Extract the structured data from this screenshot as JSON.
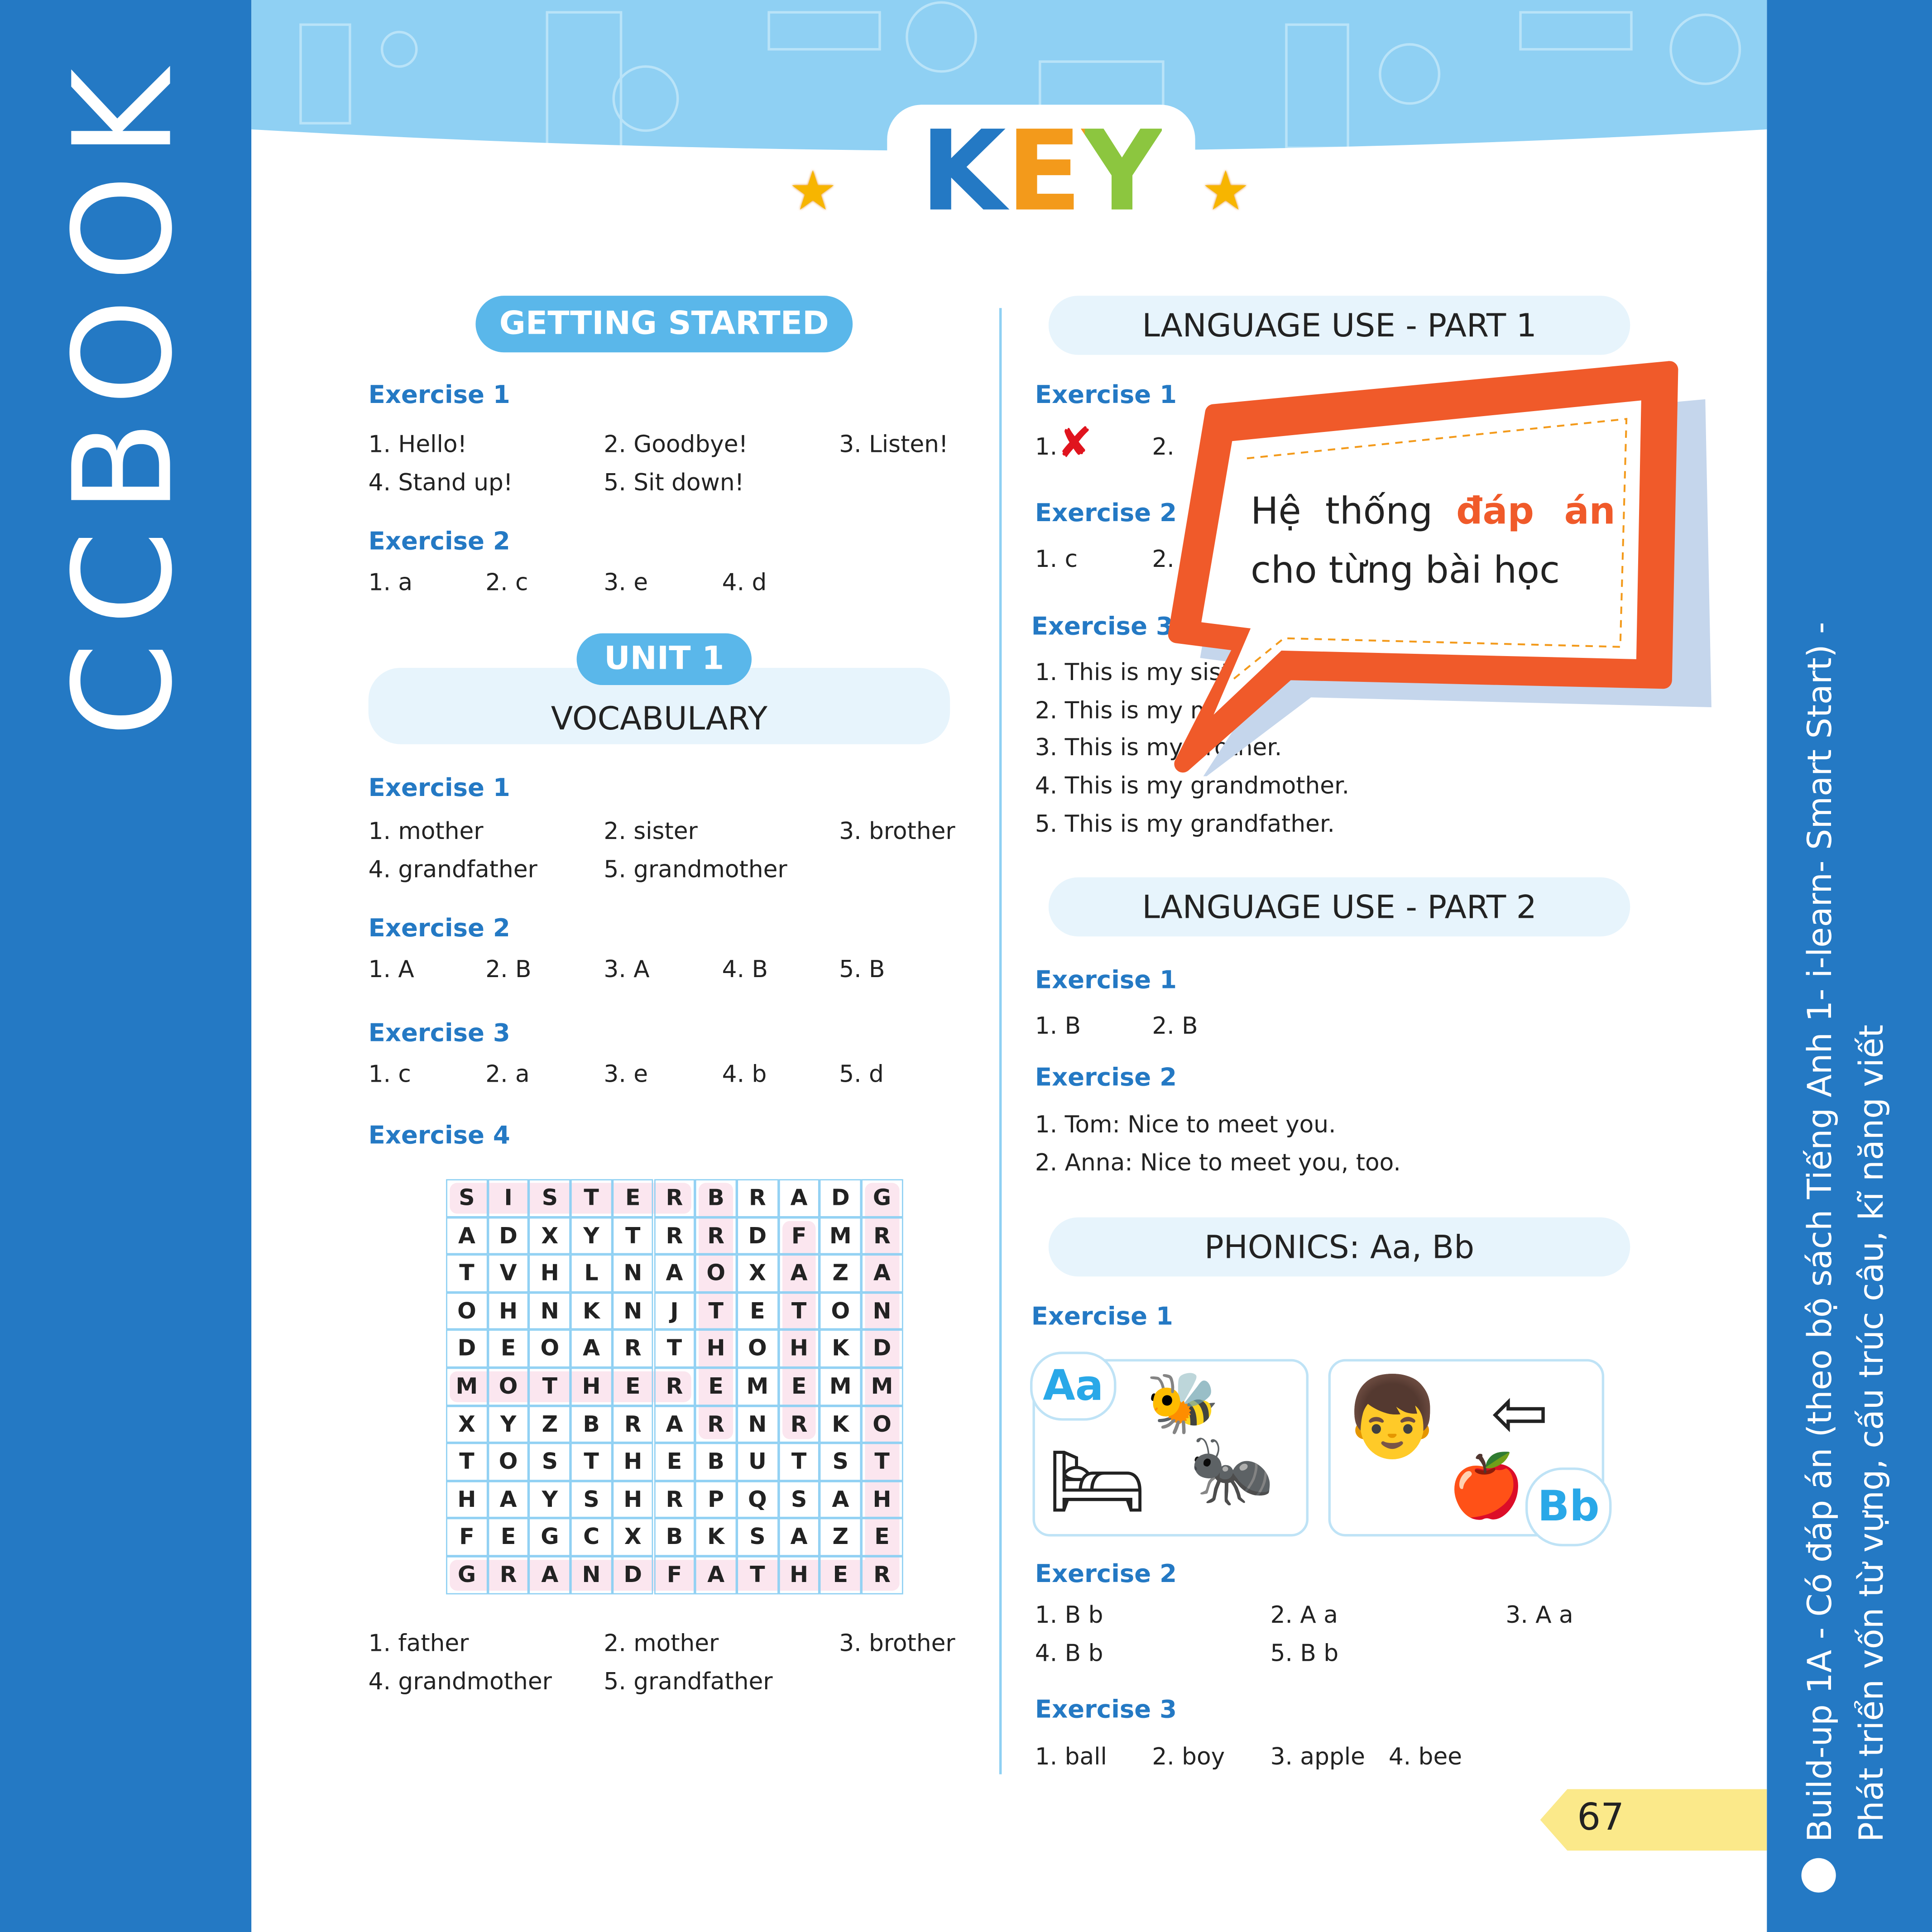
{
  "brand": "CCBOOK",
  "side_text": {
    "line1": "Build-up 1A - Có đáp án (theo bộ sách Tiếng Anh 1- i-learn- Smart Start) -",
    "line2": "Phát triển vốn từ vựng, cấu trúc câu, kĩ năng viết"
  },
  "title": "KEY",
  "colors": {
    "brand_blue": "#2479c4",
    "light_blue": "#8fd0f3",
    "orange": "#f05a2a",
    "yellow": "#fbe98a"
  },
  "left": {
    "getting_started": {
      "heading": "GETTING STARTED",
      "ex1": {
        "label": "Exercise 1",
        "answers": [
          "1. Hello!",
          "2. Goodbye!",
          "3. Listen!",
          "4. Stand up!",
          "5. Sit down!"
        ]
      },
      "ex2": {
        "label": "Exercise 2",
        "answers": [
          "1. a",
          "2. c",
          "3. e",
          "4. d"
        ]
      }
    },
    "unit": {
      "badge": "UNIT 1",
      "heading": "VOCABULARY",
      "ex1": {
        "label": "Exercise 1",
        "answers": [
          "1. mother",
          "2. sister",
          "3. brother",
          "4. grandfather",
          "5. grandmother"
        ]
      },
      "ex2": {
        "label": "Exercise 2",
        "answers": [
          "1. A",
          "2. B",
          "3. A",
          "4. B",
          "5. B"
        ]
      },
      "ex3": {
        "label": "Exercise 3",
        "answers": [
          "1. c",
          "2. a",
          "3. e",
          "4. b",
          "5. d"
        ]
      },
      "ex4": {
        "label": "Exercise 4",
        "grid": [
          "SISTERBRADG",
          "ADXYTRRDFMR",
          "TVHLNAOXAZA",
          "OHNKNJTETON",
          "DEOARTHOHKD",
          "MOTHEREMEMM",
          "XYZBRARNRKO",
          "TOSTHEBUTST",
          "HAYSHRPQSAH",
          "FEGCXBKSAZE",
          "GRANDFATHER"
        ],
        "found_words": [
          {
            "word": "SISTER",
            "row": 0,
            "col": 0,
            "dir": "across"
          },
          {
            "word": "MOTHER",
            "row": 5,
            "col": 0,
            "dir": "across"
          },
          {
            "word": "GRANDFATHER",
            "row": 10,
            "col": 0,
            "dir": "across"
          },
          {
            "word": "BROTHER",
            "row": 0,
            "col": 6,
            "dir": "down"
          },
          {
            "word": "FATHER",
            "row": 1,
            "col": 8,
            "dir": "down"
          },
          {
            "word": "GRANDMOTHER",
            "row": 0,
            "col": 10,
            "dir": "down"
          }
        ],
        "answers": [
          "1. father",
          "2. mother",
          "3. brother",
          "4. grandmother",
          "5. grandfather"
        ]
      }
    }
  },
  "right": {
    "lu1": {
      "heading": "LANGUAGE USE - PART 1",
      "ex1": {
        "label": "Exercise 1",
        "answers": [
          "1.",
          "2."
        ]
      },
      "ex2": {
        "label": "Exercise 2",
        "answers": [
          "1. c",
          "2."
        ]
      },
      "ex3": {
        "label": "Exercise 3",
        "answers": [
          "1. This is my sister.",
          "2. This is my mother.",
          "3. This is my brother.",
          "4. This is my grandmother.",
          "5. This is my grandfather."
        ]
      }
    },
    "lu2": {
      "heading": "LANGUAGE USE - PART 2",
      "ex1": {
        "label": "Exercise 1",
        "answers": [
          "1. B",
          "2. B"
        ]
      },
      "ex2": {
        "label": "Exercise 2",
        "answers": [
          "1. Tom: Nice to meet you.",
          "2. Anna: Nice to meet you, too."
        ]
      }
    },
    "phonics": {
      "heading": "PHONICS: Aa, Bb",
      "ex1": {
        "label": "Exercise 1",
        "card_a": "Aa",
        "card_b": "Bb"
      },
      "ex2": {
        "label": "Exercise 2",
        "answers": [
          "1. B b",
          "2. A a",
          "3. A a",
          "4. B b",
          "5. B b"
        ]
      },
      "ex3": {
        "label": "Exercise 3",
        "answers": [
          "1. ball",
          "2. boy",
          "3. apple",
          "4. bee"
        ]
      }
    }
  },
  "callout": {
    "normal1": "Hệ thống",
    "highlight": "đáp án",
    "line2": "cho từng bài học"
  },
  "page_number": "67"
}
